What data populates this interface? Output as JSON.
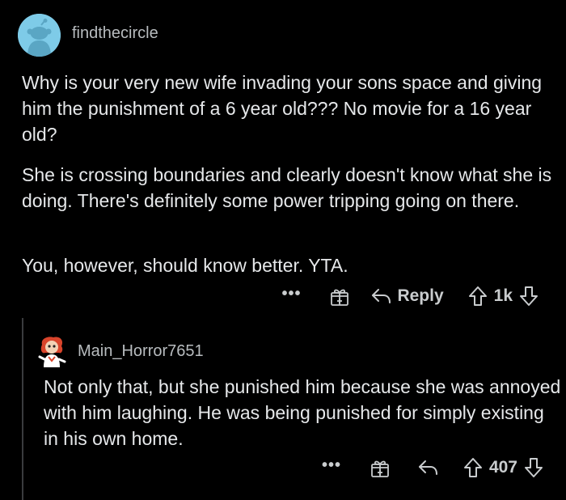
{
  "parent_comment": {
    "username": "findthecircle",
    "paragraphs": [
      "Why is your very new wife invading your sons space and giving him the punishment of a 6 year old??? No movie for a 16 year old?",
      "She is crossing boundaries and clearly doesn't know what she is doing. There's definitely some power tripping going on there.",
      "You, however, should know better. YTA."
    ],
    "actions": {
      "more_label": "•••",
      "reply_label": "Reply",
      "vote_count": "1k"
    }
  },
  "reply_comment": {
    "username": "Main_Horror7651",
    "text": "Not only that, but she punished him because she was annoyed with him laughing. He was being punished for simply existing in his own home.",
    "actions": {
      "more_label": "•••",
      "vote_count": "407"
    }
  },
  "icons": {
    "award": "gift-award-icon",
    "reply": "reply-arrow-icon",
    "upvote": "upvote-arrow-icon",
    "downvote": "downvote-arrow-icon",
    "avatar_parent": "snoo-avatar-icon",
    "avatar_reply": "custom-avatar-icon"
  },
  "colors": {
    "background": "#000000",
    "text": "#e6e8ea",
    "muted": "#b8bcbf",
    "avatar_bg": "#7ecbe8"
  }
}
